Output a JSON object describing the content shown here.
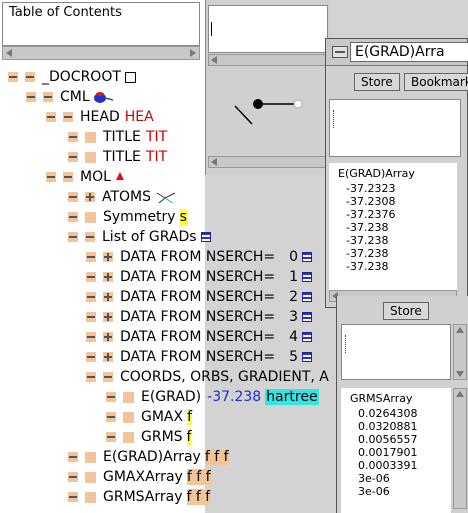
{
  "toc": {
    "title": "Table of Contents",
    "tree": [
      {
        "label": "_DOCROOT",
        "toggle": "minus"
      },
      {
        "label": "CML",
        "toggle": "minus"
      },
      {
        "label": "HEAD",
        "extra": "HEA",
        "toggle": "minus"
      },
      {
        "label": "TITLE",
        "extra": "TIT",
        "toggle": "leaf"
      },
      {
        "label": "TITLE",
        "extra": "TIT",
        "toggle": "leaf"
      },
      {
        "label": "MOL",
        "toggle": "minus"
      },
      {
        "label": "ATOMS",
        "toggle": "plus"
      },
      {
        "label": "Symmetry",
        "extra": "s",
        "toggle": "leaf"
      },
      {
        "label": "List of GRADs",
        "toggle": "minus"
      },
      {
        "label": "DATA FROM NSERCH=",
        "extra": "0",
        "toggle": "plus"
      },
      {
        "label": "DATA FROM NSERCH=",
        "extra": "1",
        "toggle": "plus"
      },
      {
        "label": "DATA FROM NSERCH=",
        "extra": "2",
        "toggle": "plus"
      },
      {
        "label": "DATA FROM NSERCH=",
        "extra": "3",
        "toggle": "plus"
      },
      {
        "label": "DATA FROM NSERCH=",
        "extra": "4",
        "toggle": "plus"
      },
      {
        "label": "DATA FROM NSERCH=",
        "extra": "5",
        "toggle": "plus"
      },
      {
        "label": "COORDS, ORBS, GRADIENT, A",
        "toggle": "minus"
      },
      {
        "label": "E(GRAD)",
        "extra": "-37.238",
        "unit": "hartree",
        "toggle": "leaf"
      },
      {
        "label": "GMAX",
        "extra": "f",
        "toggle": "leaf"
      },
      {
        "label": "GRMS",
        "extra": "f",
        "toggle": "leaf"
      },
      {
        "label": "E(GRAD)Array",
        "extra": "f f f",
        "toggle": "leaf"
      },
      {
        "label": "GMAXArray",
        "extra": "f f f",
        "toggle": "leaf"
      },
      {
        "label": "GRMSArray",
        "extra": "f f f",
        "toggle": "leaf"
      }
    ]
  },
  "egrad_window": {
    "title": "E(GRAD)Arra",
    "store_label": "Store",
    "bookmark_label": "Bookmark",
    "list_title": "E(GRAD)Array",
    "values": [
      "-37.2323",
      "-37.2308",
      "-37.2376",
      "-37.238",
      "-37.238",
      "-37.238",
      "-37.238"
    ]
  },
  "grms_window": {
    "store_label": "Store",
    "list_title": "GRMSArray",
    "values": [
      "0.0264308",
      "0.0320881",
      "0.0056557",
      "0.0017901",
      "0.0003391",
      "3e-06",
      "3e-06"
    ]
  },
  "colors": {
    "highlight_yellow": "#ffff33",
    "highlight_cyan": "#33e5e5",
    "red_text": "#d00000",
    "blue_text": "#1a2fd8",
    "toggle_fill": "#f2c49a"
  }
}
